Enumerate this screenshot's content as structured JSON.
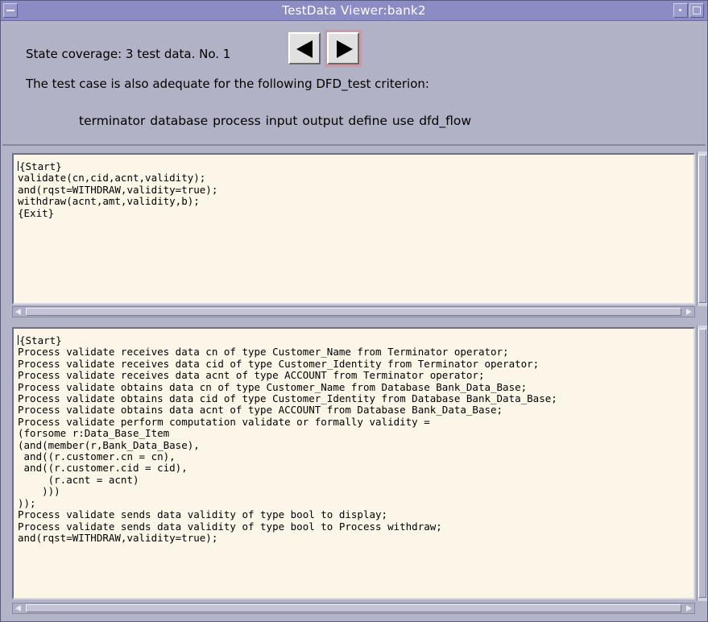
{
  "window": {
    "title": "TestData Viewer:bank2"
  },
  "header": {
    "coverage_text": "State coverage: 3 test data.  No. 1",
    "adequate_text": "The test case is also adequate for the following DFD_test criterion:",
    "criteria_text": "terminator  database  process  input  output  define  use  dfd_flow"
  },
  "nav": {
    "prev_icon": "arrow-left-icon",
    "next_icon": "arrow-right-icon"
  },
  "pane_top": {
    "text": "{Start}\nvalidate(cn,cid,acnt,validity);\nand(rqst=WITHDRAW,validity=true);\nwithdraw(acnt,amt,validity,b);\n{Exit}"
  },
  "pane_bottom": {
    "text": "{Start}\nProcess validate receives data cn of type Customer_Name from Terminator operator;\nProcess validate receives data cid of type Customer_Identity from Terminator operator;\nProcess validate receives data acnt of type ACCOUNT from Terminator operator;\nProcess validate obtains data cn of type Customer_Name from Database Bank_Data_Base;\nProcess validate obtains data cid of type Customer_Identity from Database Bank_Data_Base;\nProcess validate obtains data acnt of type ACCOUNT from Database Bank_Data_Base;\nProcess validate perform computation validate or formally validity =\n(forsome r:Data_Base_Item\n(and(member(r,Bank_Data_Base),\n and((r.customer.cn = cn),\n and((r.customer.cid = cid),\n     (r.acnt = acnt)\n    )))\n));\nProcess validate sends data validity of type bool to display;\nProcess validate sends data validity of type bool to Process withdraw;\nand(rqst=WITHDRAW,validity=true);"
  },
  "colors": {
    "title_bar": "#8c8cc4",
    "panel": "#b2b2c6",
    "text_bg": "#fbf6e8"
  }
}
